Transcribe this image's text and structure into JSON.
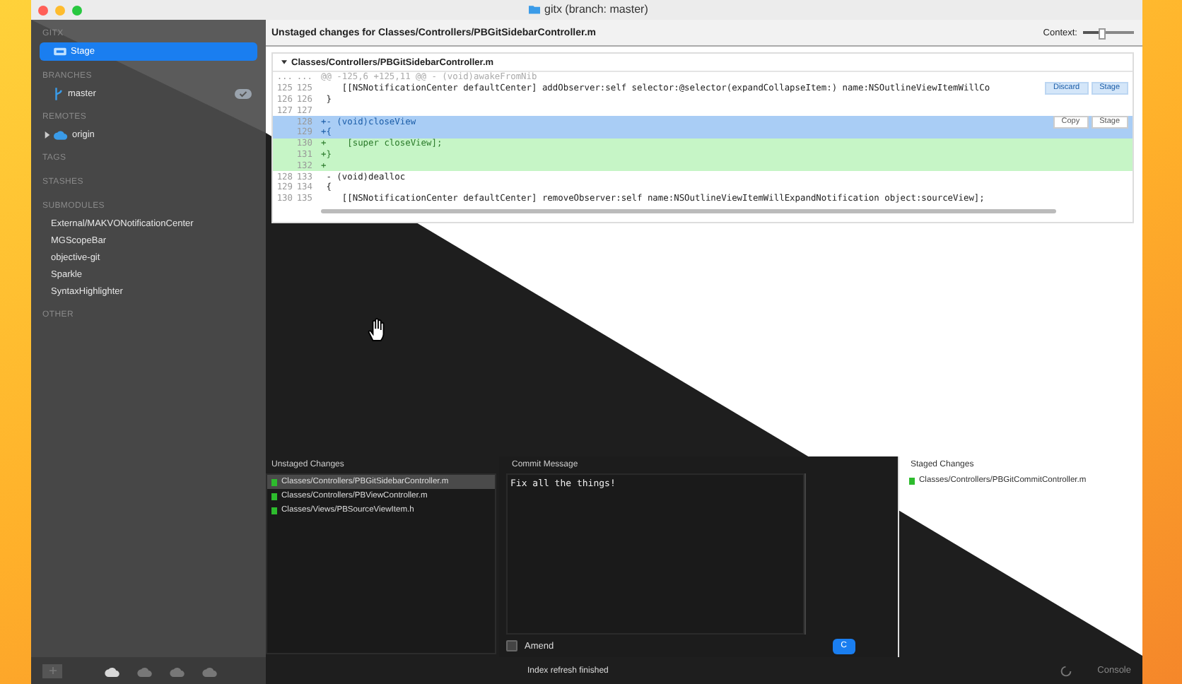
{
  "window": {
    "title": "gitx (branch: master)"
  },
  "sidebar": {
    "sections": [
      {
        "header": "GITX",
        "items": [
          {
            "label": "Stage",
            "kind": "stage",
            "selected": true,
            "current": false
          }
        ]
      },
      {
        "header": "BRANCHES",
        "items": [
          {
            "label": "master",
            "kind": "branch",
            "selected": false,
            "current": true
          }
        ]
      },
      {
        "header": "REMOTES",
        "items": [
          {
            "label": "origin",
            "kind": "remote",
            "selected": false,
            "current": false,
            "expanded": false
          }
        ]
      },
      {
        "header": "TAGS"
      },
      {
        "header": "STASHES"
      },
      {
        "header": "SUBMODULES",
        "items": [
          {
            "label": "External/MAKVONotificationCenter",
            "kind": "submodule",
            "selected": false,
            "current": false
          },
          {
            "label": "MGScopeBar",
            "kind": "submodule",
            "selected": false,
            "current": false
          },
          {
            "label": "objective-git",
            "kind": "submodule",
            "selected": false,
            "current": false
          },
          {
            "label": "Sparkle",
            "kind": "submodule",
            "selected": false,
            "current": false
          },
          {
            "label": "SyntaxHighlighter",
            "kind": "submodule",
            "selected": false,
            "current": false
          }
        ]
      },
      {
        "header": "OTHER"
      }
    ]
  },
  "diff": {
    "header": "Unstaged changes for Classes/Controllers/PBGitSidebarController.m",
    "context": {
      "label": "Context:",
      "level": 0.35
    },
    "file": {
      "name": "Classes/Controllers/PBGitSidebarController.m",
      "expanded": true
    },
    "hunk": {
      "old": "...",
      "new": "...",
      "text": "@@ -125,6 +125,11 @@ - (void)awakeFromNib"
    },
    "lines": [
      {
        "old": "125",
        "new": "125",
        "kind": "context",
        "selected": false,
        "text": "    [[NSNotificationCenter defaultCenter] addObserver:self selector:@selector(expandCollapseItem:) name:NSOutlineViewItemWillCo",
        "buttons": [
          "Discard",
          "Stage"
        ]
      },
      {
        "old": "126",
        "new": "126",
        "kind": "context",
        "selected": false,
        "text": " }"
      },
      {
        "old": "127",
        "new": "127",
        "kind": "context",
        "selected": false
      },
      {
        "new": "128",
        "kind": "added",
        "selected": true,
        "text": "+- (void)closeView",
        "buttons": [
          "Copy",
          "Stage"
        ]
      },
      {
        "new": "129",
        "kind": "added",
        "selected": true,
        "text": "+{"
      },
      {
        "new": "130",
        "kind": "added",
        "selected": false,
        "text": "+    [super closeView];"
      },
      {
        "new": "131",
        "kind": "added",
        "selected": false,
        "text": "+}"
      },
      {
        "new": "132",
        "kind": "added",
        "selected": false,
        "text": "+"
      },
      {
        "old": "128",
        "new": "133",
        "kind": "context",
        "selected": false,
        "text": " - (void)dealloc"
      },
      {
        "old": "129",
        "new": "134",
        "kind": "context",
        "selected": false,
        "text": " {"
      },
      {
        "old": "130",
        "new": "135",
        "kind": "context",
        "selected": false,
        "text": "    [[NSNotificationCenter defaultCenter] removeObserver:self name:NSOutlineViewItemWillExpandNotification object:sourceView];"
      }
    ]
  },
  "unstaged": {
    "title": "Unstaged Changes",
    "files": [
      {
        "name": "Classes/Controllers/PBGitSidebarController.m",
        "selected": true
      },
      {
        "name": "Classes/Controllers/PBViewController.m",
        "selected": false
      },
      {
        "name": "Classes/Views/PBSourceViewItem.h",
        "selected": false
      }
    ]
  },
  "commit": {
    "title": "Commit Message",
    "value": "Fix all the things!",
    "amend": {
      "label": "Amend",
      "checked": false
    },
    "button": "C"
  },
  "staged": {
    "title": "Staged Changes",
    "files": [
      {
        "name": "Classes/Controllers/PBGitCommitController.m",
        "selected": false
      }
    ]
  },
  "status_bar": {
    "message": "Index refresh finished",
    "console": "Console"
  }
}
